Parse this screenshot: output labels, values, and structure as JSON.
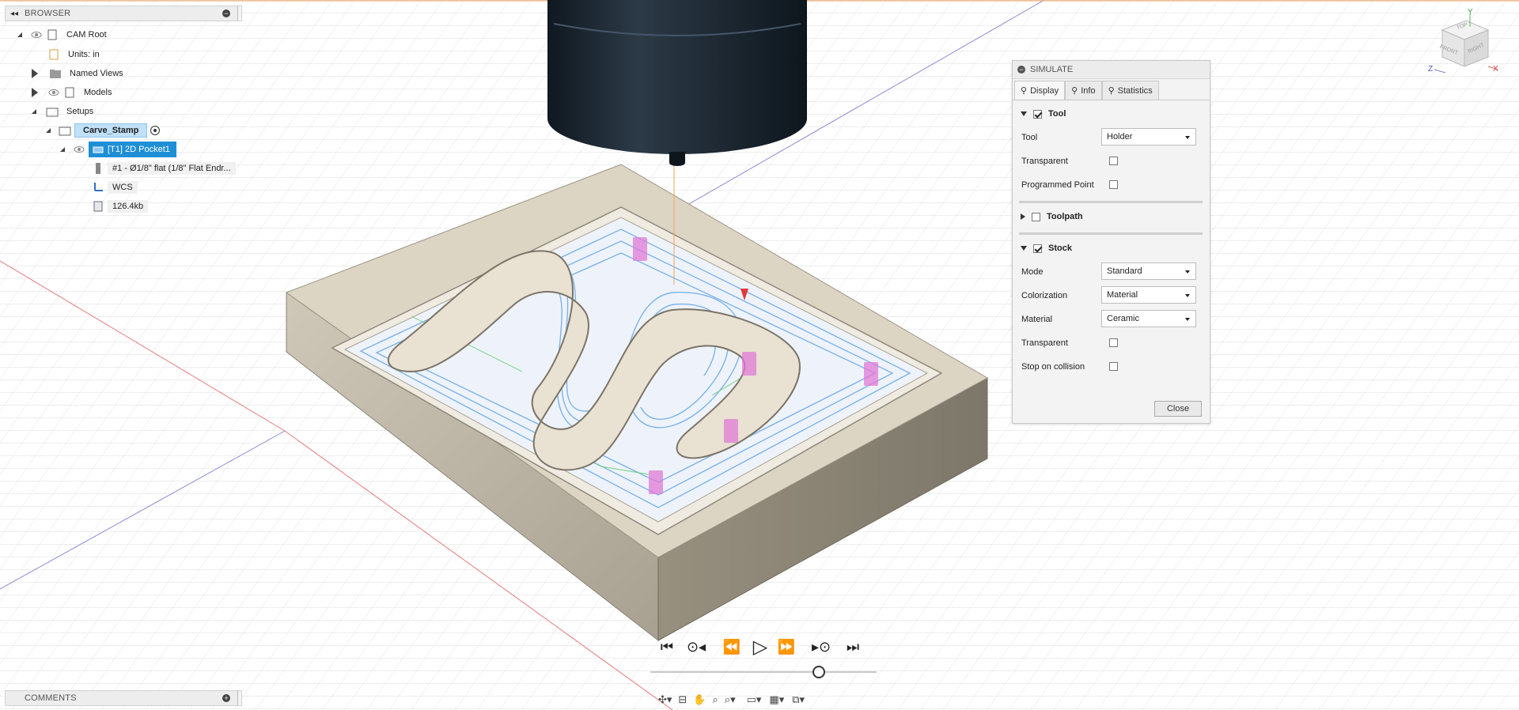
{
  "browser": {
    "title": "BROWSER",
    "items": [
      {
        "label": "CAM Root"
      },
      {
        "label": "Units: in"
      },
      {
        "label": "Named Views"
      },
      {
        "label": "Models"
      },
      {
        "label": "Setups"
      },
      {
        "label": "Carve_Stamp"
      },
      {
        "label": "[T1] 2D Pocket1"
      },
      {
        "label": "#1 - Ø1/8\" flat (1/8\" Flat Endr..."
      },
      {
        "label": "WCS"
      },
      {
        "label": "126.4kb"
      }
    ]
  },
  "comments": {
    "title": "COMMENTS"
  },
  "simulate": {
    "title": "SIMULATE",
    "tabs": [
      {
        "label": "Display"
      },
      {
        "label": "Info"
      },
      {
        "label": "Statistics"
      }
    ],
    "tool_section": {
      "label": "Tool",
      "checked": true
    },
    "tool": {
      "label": "Tool",
      "value": "Holder"
    },
    "transparent1": {
      "label": "Transparent",
      "checked": false
    },
    "programmed_point": {
      "label": "Programmed Point",
      "checked": false
    },
    "toolpath_section": {
      "label": "Toolpath",
      "checked": false
    },
    "stock_section": {
      "label": "Stock",
      "checked": true
    },
    "mode": {
      "label": "Mode",
      "value": "Standard"
    },
    "colorization": {
      "label": "Colorization",
      "value": "Material"
    },
    "material": {
      "label": "Material",
      "value": "Ceramic"
    },
    "transparent2": {
      "label": "Transparent",
      "checked": false
    },
    "stop_on_collision": {
      "label": "Stop on collision",
      "checked": false
    },
    "close_label": "Close"
  },
  "viewcube": {
    "top": "TOP",
    "front": "FRONT",
    "right": "RIGHT",
    "axis_x": "X",
    "axis_y": "Y",
    "axis_z": "Z"
  },
  "colors": {
    "selection": "#1e8fd6",
    "stock": "#d9d1c0",
    "toolpath": "#6aa8e6",
    "tool": "#1d2a36"
  }
}
